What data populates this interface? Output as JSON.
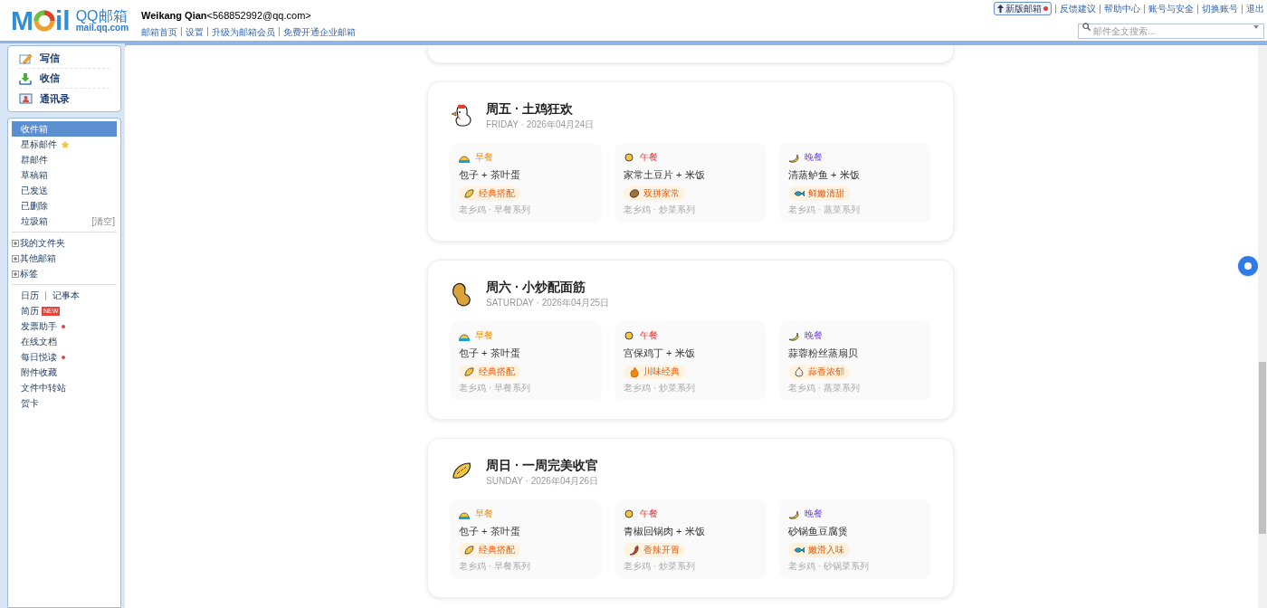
{
  "header": {
    "logo_left": "M",
    "logo_right": "il",
    "brand": "QQ邮箱",
    "brand_url": "mail.qq.com",
    "user_name": "Weikang Qian",
    "user_email": "<568852992@qq.com>",
    "links": [
      "邮箱首页",
      "设置",
      "升级为邮箱会员",
      "免费开通企业邮箱"
    ],
    "new_version": {
      "label": "新版邮箱",
      "dot": true
    },
    "top_links": [
      "反馈建议",
      "帮助中心",
      "账号与安全",
      "切换账号",
      "退出"
    ],
    "search": {
      "placeholder": "邮件全文搜索..."
    }
  },
  "sidebar": {
    "actions": [
      {
        "kind": "write",
        "label": "写信"
      },
      {
        "kind": "receive",
        "label": "收信"
      },
      {
        "kind": "contacts",
        "label": "通讯录"
      }
    ],
    "folders": [
      {
        "label": "收件箱",
        "selected": true
      },
      {
        "label": "星标邮件",
        "selected": false,
        "star": true
      },
      {
        "label": "群邮件",
        "selected": false
      },
      {
        "label": "草稿箱",
        "selected": false
      },
      {
        "label": "已发送",
        "selected": false
      },
      {
        "label": "已删除",
        "selected": false
      },
      {
        "label": "垃圾箱",
        "selected": false,
        "action": "[清空]"
      }
    ],
    "groups": [
      {
        "label": "我的文件夹",
        "expanded": false
      },
      {
        "label": "其他邮箱",
        "expanded": false
      },
      {
        "label": "标签",
        "expanded": false
      }
    ],
    "tools_pair": [
      "日历",
      "记事本"
    ],
    "tools": [
      {
        "label": "简历",
        "badge": "NEW"
      },
      {
        "label": "发票助手",
        "dot": true
      },
      {
        "label": "在线文档"
      },
      {
        "label": "每日悦读",
        "dot": true
      },
      {
        "label": "附件收藏"
      },
      {
        "label": "文件中转站"
      },
      {
        "label": "贺卡"
      }
    ]
  },
  "days": [
    {
      "kind": "chicken",
      "title": "周五 · 土鸡狂欢",
      "subtitle": "FRIDAY · 2026年04月24日",
      "meals": [
        {
          "kind": "breakfast",
          "label": "早餐",
          "dish": "包子 + 茶叶蛋",
          "tag": {
            "kind": "dumpling",
            "text": "经典搭配"
          },
          "note": "老乡鸡 · 早餐系列"
        },
        {
          "kind": "lunch",
          "label": "午餐",
          "dish": "家常土豆片 + 米饭",
          "tag": {
            "kind": "potato",
            "text": "双拼家常"
          },
          "note": "老乡鸡 · 炒菜系列"
        },
        {
          "kind": "dinner",
          "label": "晚餐",
          "dish": "清蒸鲈鱼 + 米饭",
          "tag": {
            "kind": "fish",
            "text": "鲜嫩清甜"
          },
          "note": "老乡鸡 · 蒸菜系列"
        }
      ]
    },
    {
      "kind": "peanut",
      "title": "周六 · 小炒配面筋",
      "subtitle": "SATURDAY · 2026年04月25日",
      "meals": [
        {
          "kind": "breakfast",
          "label": "早餐",
          "dish": "包子 + 茶叶蛋",
          "tag": {
            "kind": "dumpling",
            "text": "经典搭配"
          },
          "note": "老乡鸡 · 早餐系列"
        },
        {
          "kind": "lunch",
          "label": "午餐",
          "dish": "宫保鸡丁 + 米饭",
          "tag": {
            "kind": "flame",
            "text": "川味经典"
          },
          "note": "老乡鸡 · 炒菜系列"
        },
        {
          "kind": "dinner",
          "label": "晚餐",
          "dish": "蒜蓉粉丝蒸扇贝",
          "tag": {
            "kind": "garlic",
            "text": "蒜香浓郁"
          },
          "note": "老乡鸡 · 蒸菜系列"
        }
      ]
    },
    {
      "kind": "dumpling",
      "title": "周日 · 一周完美收官",
      "subtitle": "SUNDAY · 2026年04月26日",
      "meals": [
        {
          "kind": "breakfast",
          "label": "早餐",
          "dish": "包子 + 茶叶蛋",
          "tag": {
            "kind": "dumpling",
            "text": "经典搭配"
          },
          "note": "老乡鸡 · 早餐系列"
        },
        {
          "kind": "lunch",
          "label": "午餐",
          "dish": "青椒回锅肉 + 米饭",
          "tag": {
            "kind": "chili",
            "text": "香辣开胃"
          },
          "note": "老乡鸡 · 炒菜系列"
        },
        {
          "kind": "dinner",
          "label": "晚餐",
          "dish": "砂锅鱼豆腐煲",
          "tag": {
            "kind": "fish",
            "text": "嫩滑入味"
          },
          "note": "老乡鸡 · 砂锅菜系列"
        }
      ]
    }
  ]
}
